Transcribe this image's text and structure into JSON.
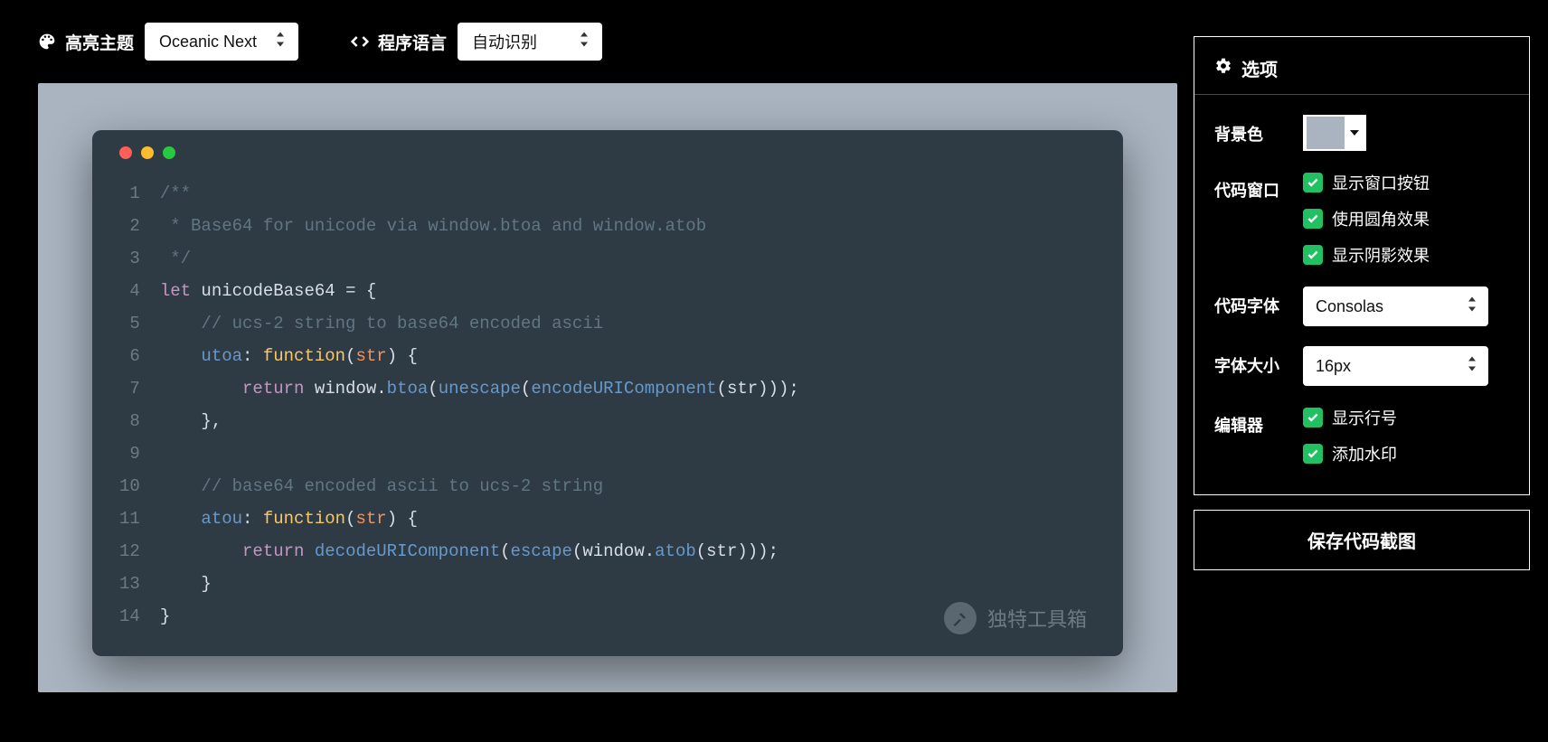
{
  "toolbar": {
    "theme_label": "高亮主题",
    "theme_value": "Oceanic Next",
    "lang_label": "程序语言",
    "lang_value": "自动识别"
  },
  "panel": {
    "title": "选项",
    "bg_label": "背景色",
    "bg_swatch": "#a9b4c0",
    "window_label": "代码窗口",
    "window_opts": {
      "show_buttons": "显示窗口按钮",
      "rounded": "使用圆角效果",
      "shadow": "显示阴影效果"
    },
    "font_label": "代码字体",
    "font_value": "Consolas",
    "fontsize_label": "字体大小",
    "fontsize_value": "16px",
    "editor_label": "编辑器",
    "editor_opts": {
      "lineno": "显示行号",
      "watermark": "添加水印"
    }
  },
  "save_button": "保存代码截图",
  "watermark_text": "独特工具箱",
  "line_count": 14,
  "code_tokens": [
    [
      [
        "c-comment",
        "/**"
      ]
    ],
    [
      [
        "c-comment",
        " * Base64 for unicode via window.btoa and window.atob"
      ]
    ],
    [
      [
        "c-comment",
        " */"
      ]
    ],
    [
      [
        "c-kw",
        "let"
      ],
      [
        "c-id",
        " unicodeBase64 "
      ],
      [
        "c-punc",
        "= {"
      ]
    ],
    [
      [
        "c-id",
        "    "
      ],
      [
        "c-comment",
        "// ucs-2 string to base64 encoded ascii"
      ]
    ],
    [
      [
        "c-id",
        "    "
      ],
      [
        "c-prop",
        "utoa"
      ],
      [
        "c-punc",
        ": "
      ],
      [
        "c-func",
        "function"
      ],
      [
        "c-punc",
        "("
      ],
      [
        "c-param",
        "str"
      ],
      [
        "c-punc",
        ") {"
      ]
    ],
    [
      [
        "c-id",
        "        "
      ],
      [
        "c-kw",
        "return"
      ],
      [
        "c-id",
        " window."
      ],
      [
        "c-fname",
        "btoa"
      ],
      [
        "c-punc",
        "("
      ],
      [
        "c-fname",
        "unescape"
      ],
      [
        "c-punc",
        "("
      ],
      [
        "c-fname",
        "encodeURIComponent"
      ],
      [
        "c-punc",
        "(str)));"
      ]
    ],
    [
      [
        "c-id",
        "    },"
      ]
    ],
    [
      [
        "c-id",
        ""
      ]
    ],
    [
      [
        "c-id",
        "    "
      ],
      [
        "c-comment",
        "// base64 encoded ascii to ucs-2 string"
      ]
    ],
    [
      [
        "c-id",
        "    "
      ],
      [
        "c-prop",
        "atou"
      ],
      [
        "c-punc",
        ": "
      ],
      [
        "c-func",
        "function"
      ],
      [
        "c-punc",
        "("
      ],
      [
        "c-param",
        "str"
      ],
      [
        "c-punc",
        ") {"
      ]
    ],
    [
      [
        "c-id",
        "        "
      ],
      [
        "c-kw",
        "return"
      ],
      [
        "c-id",
        " "
      ],
      [
        "c-fname",
        "decodeURIComponent"
      ],
      [
        "c-punc",
        "("
      ],
      [
        "c-fname",
        "escape"
      ],
      [
        "c-punc",
        "(window."
      ],
      [
        "c-fname",
        "atob"
      ],
      [
        "c-punc",
        "(str)));"
      ]
    ],
    [
      [
        "c-id",
        "    }"
      ]
    ],
    [
      [
        "c-id",
        "}"
      ]
    ]
  ]
}
